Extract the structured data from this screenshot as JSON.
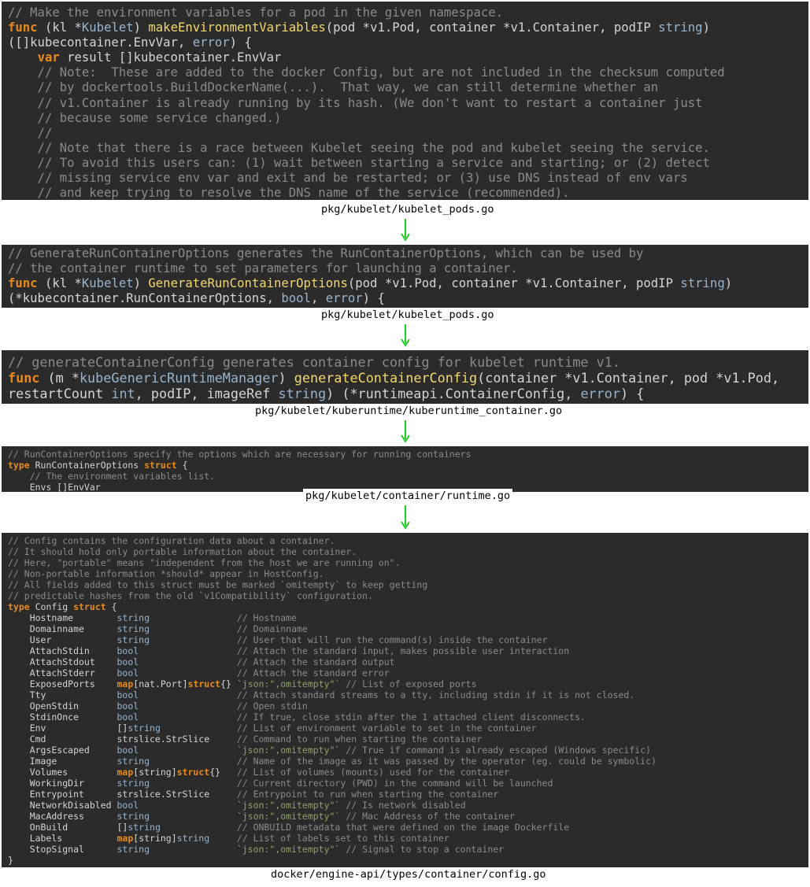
{
  "blocks": [
    {
      "file": "pkg/kubelet/kubelet_pods.go",
      "lines": [
        [
          [
            "cm",
            "// Make the environment variables for a pod in the given namespace."
          ]
        ],
        [
          [
            "kw",
            "func"
          ],
          [
            "",
            " (kl *"
          ],
          [
            "ty",
            "Kubelet"
          ],
          [
            "",
            ") "
          ],
          [
            "fn",
            "makeEnvironmentVariables"
          ],
          [
            "",
            "(pod *v1.Pod, container *v1.Container, podIP "
          ],
          [
            "ty",
            "string"
          ],
          [
            "",
            ")"
          ]
        ],
        [
          [
            "",
            "([]kubecontainer.EnvVar, "
          ],
          [
            "ty",
            "error"
          ],
          [
            "",
            ") {"
          ]
        ],
        [
          [
            "",
            "    "
          ],
          [
            "kw",
            "var"
          ],
          [
            "",
            " result []kubecontainer.EnvVar"
          ]
        ],
        [
          [
            "cm",
            "    // Note:  These are added to the docker Config, but are not included in the checksum computed"
          ]
        ],
        [
          [
            "cm",
            "    // by dockertools.BuildDockerName(...).  That way, we can still determine whether an"
          ]
        ],
        [
          [
            "cm",
            "    // v1.Container is already running by its hash. (We don't want to restart a container just"
          ]
        ],
        [
          [
            "cm",
            "    // because some service changed.)"
          ]
        ],
        [
          [
            "cm",
            "    //"
          ]
        ],
        [
          [
            "cm",
            "    // Note that there is a race between Kubelet seeing the pod and kubelet seeing the service."
          ]
        ],
        [
          [
            "cm",
            "    // To avoid this users can: (1) wait between starting a service and starting; or (2) detect"
          ]
        ],
        [
          [
            "cm",
            "    // missing service env var and exit and be restarted; or (3) use DNS instead of env vars"
          ]
        ],
        [
          [
            "cm",
            "    // and keep trying to resolve the DNS name of the service (recommended)."
          ]
        ]
      ]
    },
    {
      "file": "pkg/kubelet/kubelet_pods.go",
      "lines": [
        [
          [
            "cm",
            "// GenerateRunContainerOptions generates the RunContainerOptions, which can be used by"
          ]
        ],
        [
          [
            "cm",
            "// the container runtime to set parameters for launching a container."
          ]
        ],
        [
          [
            "kw",
            "func"
          ],
          [
            "",
            " (kl *"
          ],
          [
            "ty",
            "Kubelet"
          ],
          [
            "",
            ") "
          ],
          [
            "fn",
            "GenerateRunContainerOptions"
          ],
          [
            "",
            "(pod *v1.Pod, container *v1.Container, podIP "
          ],
          [
            "ty",
            "string"
          ],
          [
            "",
            ")"
          ]
        ],
        [
          [
            "",
            "(*kubecontainer.RunContainerOptions, "
          ],
          [
            "ty",
            "bool"
          ],
          [
            "",
            ", "
          ],
          [
            "ty",
            "error"
          ],
          [
            "",
            ") {"
          ]
        ]
      ]
    },
    {
      "file": "pkg/kubelet/kuberuntime/kuberuntime_container.go",
      "lines": [
        [
          [
            "cm",
            "// generateContainerConfig generates container config for kubelet runtime v1."
          ]
        ],
        [
          [
            "kw",
            "func"
          ],
          [
            "",
            " (m *"
          ],
          [
            "ty",
            "kubeGenericRuntimeManager"
          ],
          [
            "",
            ") "
          ],
          [
            "fn",
            "generateContainerConfig"
          ],
          [
            "",
            "(container *v1.Container, pod *v1.Pod,"
          ]
        ],
        [
          [
            "",
            "restartCount "
          ],
          [
            "ty",
            "int"
          ],
          [
            "",
            ", podIP, imageRef "
          ],
          [
            "ty",
            "string"
          ],
          [
            "",
            ") (*runtimeapi.ContainerConfig, "
          ],
          [
            "ty",
            "error"
          ],
          [
            "",
            ") {"
          ]
        ]
      ]
    },
    {
      "file": "pkg/kubelet/container/runtime.go",
      "lines": [
        [
          [
            "cm",
            "// RunContainerOptions specify the options which are necessary for running containers"
          ]
        ],
        [
          [
            "kw",
            "type"
          ],
          [
            "",
            " RunContainerOptions "
          ],
          [
            "kw",
            "struct"
          ],
          [
            "",
            " {"
          ]
        ],
        [
          [
            "cm",
            "    // The environment variables list."
          ]
        ],
        [
          [
            "",
            "    Envs []EnvVar"
          ]
        ]
      ]
    },
    {
      "file": "docker/engine-api/types/container/config.go",
      "lines": [
        [
          [
            "cm",
            "// Config contains the configuration data about a container."
          ]
        ],
        [
          [
            "cm",
            "// It should hold only portable information about the container."
          ]
        ],
        [
          [
            "cm",
            "// Here, \"portable\" means \"independent from the host we are running on\"."
          ]
        ],
        [
          [
            "cm",
            "// Non-portable information *should* appear in HostConfig."
          ]
        ],
        [
          [
            "cm",
            "// All fields added to this struct must be marked `omitempty` to keep getting"
          ]
        ],
        [
          [
            "cm",
            "// predictable hashes from the old `v1Compatibility` configuration."
          ]
        ],
        [
          [
            "kw",
            "type"
          ],
          [
            "",
            " Config "
          ],
          [
            "kw",
            "struct"
          ],
          [
            "",
            " {"
          ]
        ],
        [
          [
            "",
            "    Hostname        "
          ],
          [
            "ty",
            "string"
          ],
          [
            "",
            "                "
          ],
          [
            "cm",
            "// Hostname"
          ]
        ],
        [
          [
            "",
            "    Domainname      "
          ],
          [
            "ty",
            "string"
          ],
          [
            "",
            "                "
          ],
          [
            "cm",
            "// Domainname"
          ]
        ],
        [
          [
            "",
            "    User            "
          ],
          [
            "ty",
            "string"
          ],
          [
            "",
            "                "
          ],
          [
            "cm",
            "// User that will run the command(s) inside the container"
          ]
        ],
        [
          [
            "",
            "    AttachStdin     "
          ],
          [
            "ty",
            "bool"
          ],
          [
            "",
            "                  "
          ],
          [
            "cm",
            "// Attach the standard input, makes possible user interaction"
          ]
        ],
        [
          [
            "",
            "    AttachStdout    "
          ],
          [
            "ty",
            "bool"
          ],
          [
            "",
            "                  "
          ],
          [
            "cm",
            "// Attach the standard output"
          ]
        ],
        [
          [
            "",
            "    AttachStderr    "
          ],
          [
            "ty",
            "bool"
          ],
          [
            "",
            "                  "
          ],
          [
            "cm",
            "// Attach the standard error"
          ]
        ],
        [
          [
            "",
            "    ExposedPorts    "
          ],
          [
            "kw",
            "map"
          ],
          [
            "",
            "[nat.Port]"
          ],
          [
            "kw",
            "struct"
          ],
          [
            "",
            "{} "
          ],
          [
            "st",
            "`json:\",omitempty\"`"
          ],
          [
            "",
            " "
          ],
          [
            "cm",
            "// List of exposed ports"
          ]
        ],
        [
          [
            "",
            "    Tty             "
          ],
          [
            "ty",
            "bool"
          ],
          [
            "",
            "                  "
          ],
          [
            "cm",
            "// Attach standard streams to a tty, including stdin if it is not closed."
          ]
        ],
        [
          [
            "",
            "    OpenStdin       "
          ],
          [
            "ty",
            "bool"
          ],
          [
            "",
            "                  "
          ],
          [
            "cm",
            "// Open stdin"
          ]
        ],
        [
          [
            "",
            "    StdinOnce       "
          ],
          [
            "ty",
            "bool"
          ],
          [
            "",
            "                  "
          ],
          [
            "cm",
            "// If true, close stdin after the 1 attached client disconnects."
          ]
        ],
        [
          [
            "",
            "    Env             []"
          ],
          [
            "ty",
            "string"
          ],
          [
            "",
            "              "
          ],
          [
            "cm",
            "// List of environment variable to set in the container"
          ]
        ],
        [
          [
            "",
            "    Cmd             strslice.StrSlice     "
          ],
          [
            "cm",
            "// Command to run when starting the container"
          ]
        ],
        [
          [
            "",
            "    ArgsEscaped     "
          ],
          [
            "ty",
            "bool"
          ],
          [
            "",
            "                  "
          ],
          [
            "st",
            "`json:\",omitempty\"`"
          ],
          [
            "",
            " "
          ],
          [
            "cm",
            "// True if command is already escaped (Windows specific)"
          ]
        ],
        [
          [
            "",
            "    Image           "
          ],
          [
            "ty",
            "string"
          ],
          [
            "",
            "                "
          ],
          [
            "cm",
            "// Name of the image as it was passed by the operator (eg. could be symbolic)"
          ]
        ],
        [
          [
            "",
            "    Volumes         "
          ],
          [
            "kw",
            "map"
          ],
          [
            "",
            "[string]"
          ],
          [
            "kw",
            "struct"
          ],
          [
            "",
            "{}   "
          ],
          [
            "cm",
            "// List of volumes (mounts) used for the container"
          ]
        ],
        [
          [
            "",
            "    WorkingDir      "
          ],
          [
            "ty",
            "string"
          ],
          [
            "",
            "                "
          ],
          [
            "cm",
            "// Current directory (PWD) in the command will be launched"
          ]
        ],
        [
          [
            "",
            "    Entrypoint      strslice.StrSlice     "
          ],
          [
            "cm",
            "// Entrypoint to run when starting the container"
          ]
        ],
        [
          [
            "",
            "    NetworkDisabled "
          ],
          [
            "ty",
            "bool"
          ],
          [
            "",
            "                  "
          ],
          [
            "st",
            "`json:\",omitempty\"`"
          ],
          [
            "",
            " "
          ],
          [
            "cm",
            "// Is network disabled"
          ]
        ],
        [
          [
            "",
            "    MacAddress      "
          ],
          [
            "ty",
            "string"
          ],
          [
            "",
            "                "
          ],
          [
            "st",
            "`json:\",omitempty\"`"
          ],
          [
            "",
            " "
          ],
          [
            "cm",
            "// Mac Address of the container"
          ]
        ],
        [
          [
            "",
            "    OnBuild         []"
          ],
          [
            "ty",
            "string"
          ],
          [
            "",
            "              "
          ],
          [
            "cm",
            "// ONBUILD metadata that were defined on the image Dockerfile"
          ]
        ],
        [
          [
            "",
            "    Labels          "
          ],
          [
            "kw",
            "map"
          ],
          [
            "",
            "[string]"
          ],
          [
            "ty",
            "string"
          ],
          [
            "",
            "     "
          ],
          [
            "cm",
            "// List of labels set to this container"
          ]
        ],
        [
          [
            "",
            "    StopSignal      "
          ],
          [
            "ty",
            "string"
          ],
          [
            "",
            "                "
          ],
          [
            "st",
            "`json:\",omitempty\"`"
          ],
          [
            "",
            " "
          ],
          [
            "cm",
            "// Signal to stop a container"
          ]
        ],
        [
          [
            "",
            "}"
          ]
        ]
      ]
    }
  ]
}
